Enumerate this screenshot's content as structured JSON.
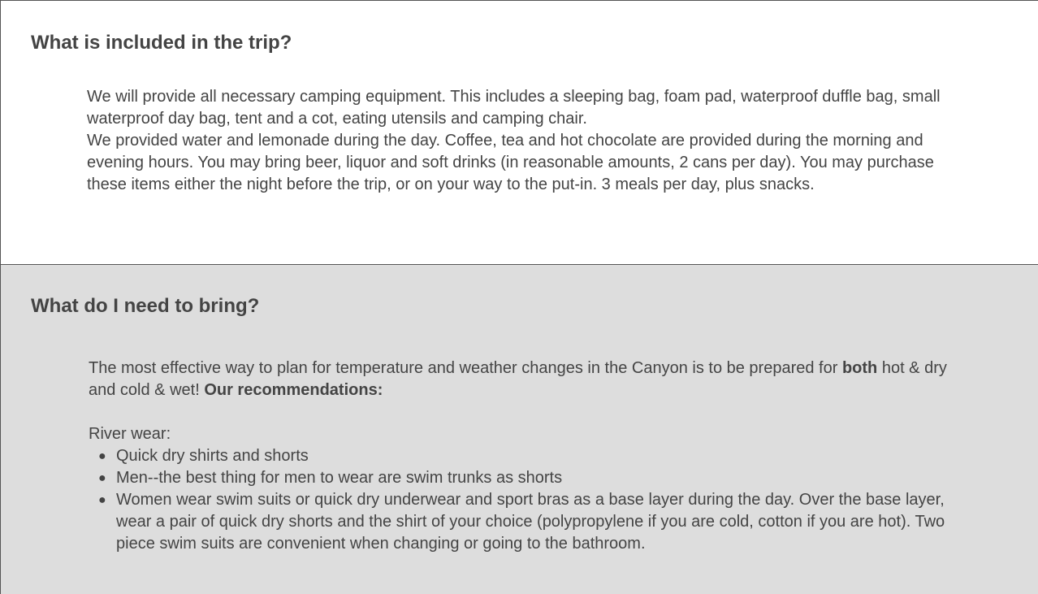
{
  "included": {
    "heading": "What is included in the trip?",
    "paragraph1": "We will provide all necessary camping equipment. This includes a sleeping bag, foam pad, waterproof duffle bag, small waterproof day bag, tent and a cot, eating utensils and camping chair.",
    "paragraph2": "We provided water and lemonade during the day. Coffee, tea and hot chocolate are provided during the morning and evening hours. You may bring beer, liquor and soft drinks (in reasonable amounts, 2 cans per day). You may purchase these items either the night before the trip, or on your way to the put-in. 3 meals per day, plus snacks."
  },
  "bring": {
    "heading": "What do I need to bring?",
    "intro_before": "The most effective way to plan for temperature and weather changes in the Canyon is to be prepared for ",
    "intro_bold1": "both",
    "intro_middle": " hot & dry and cold & wet! ",
    "intro_bold2": "Our recommendations:",
    "river_wear_label": "River wear:",
    "river_wear_items": [
      "Quick dry shirts and shorts",
      "Men--the best thing for men to wear are swim trunks as shorts",
      "Women wear swim suits or quick dry underwear and sport bras as a base layer during the day. Over the base layer, wear a pair of quick dry shorts and the shirt of your choice (polypropylene if you are cold, cotton if you are hot). Two piece swim suits are convenient when changing or going to the bathroom."
    ]
  },
  "colors": {
    "text": "#444444",
    "section_alt_bg": "#dddddd",
    "border": "#555555"
  }
}
